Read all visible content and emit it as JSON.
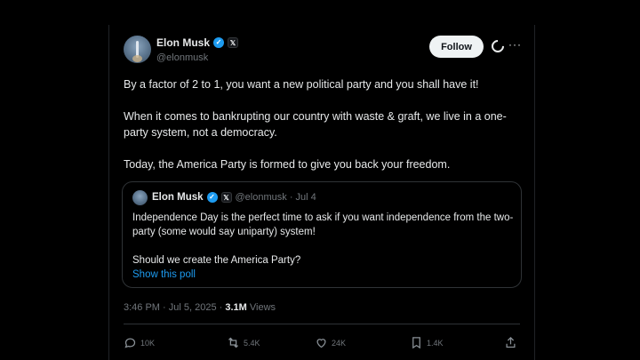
{
  "author": {
    "name": "Elon Musk",
    "handle": "@elonmusk",
    "verified_glyph": "✓",
    "x_badge": "𝕏"
  },
  "follow_label": "Follow",
  "more_glyph": "···",
  "body": {
    "p1": "By a factor of 2 to 1, you want a new political party and you shall have it!",
    "p2": "When it comes to bankrupting our country with waste & graft, we live in a one-party system, not a democracy.",
    "p3": "Today, the America Party is formed to give you back your freedom."
  },
  "quote": {
    "name": "Elon Musk",
    "meta": "@elonmusk · Jul 4",
    "line1": "Independence Day is the perfect time to ask if you want independence from the two-party (some would say uniparty) system!",
    "line2": "Should we create the America Party?",
    "poll_link": "Show this poll"
  },
  "meta": {
    "timestamp": "3:46 PM · Jul 5, 2025 · ",
    "views_count": "3.1M",
    "views_label": " Views"
  },
  "actions": {
    "replies": "10K",
    "reposts": "5.4K",
    "likes": "24K",
    "bookmarks": "1.4K"
  },
  "colors": {
    "accent": "#1d9bf0",
    "background": "#000000",
    "text": "#e7e9ea",
    "muted": "#71767b"
  }
}
